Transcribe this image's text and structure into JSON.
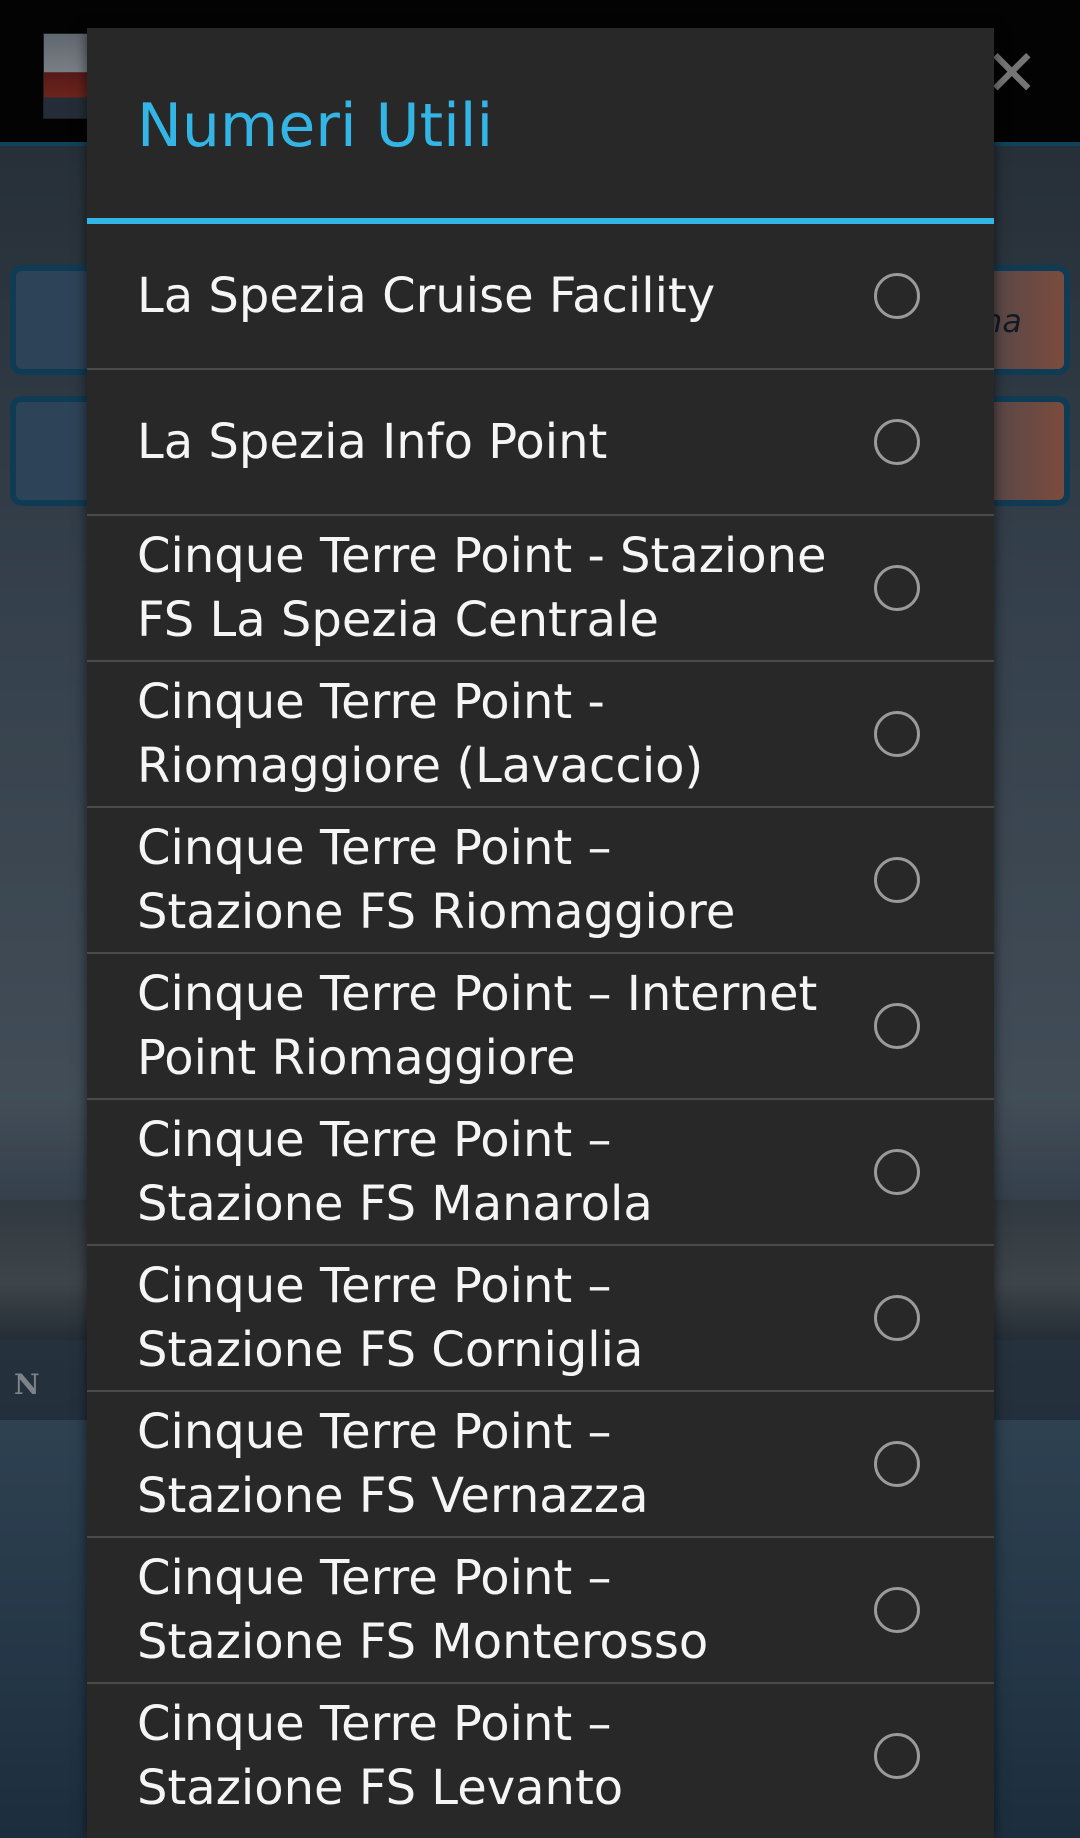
{
  "dialog": {
    "title": "Numeri Utili",
    "options": [
      {
        "label": "La Spezia Cruise Facility",
        "selected": false
      },
      {
        "label": "La Spezia Info Point",
        "selected": false
      },
      {
        "label": "Cinque Terre Point - Stazione FS La Spezia Centrale",
        "selected": false
      },
      {
        "label": "Cinque Terre Point - Riomaggiore (Lavaccio)",
        "selected": false
      },
      {
        "label": "Cinque Terre Point – Stazione FS Riomaggiore",
        "selected": false
      },
      {
        "label": "Cinque Terre Point – Internet Point Riomaggiore",
        "selected": false
      },
      {
        "label": "Cinque Terre Point – Stazione FS Manarola",
        "selected": false
      },
      {
        "label": "Cinque Terre Point – Stazione FS Corniglia",
        "selected": false
      },
      {
        "label": "Cinque Terre Point – Stazione FS Vernazza",
        "selected": false
      },
      {
        "label": "Cinque Terre Point – Stazione FS Monterosso",
        "selected": false
      },
      {
        "label": "Cinque Terre Point – Stazione FS Levanto",
        "selected": false
      }
    ]
  },
  "background": {
    "button_fragment": "na",
    "image_letter": "N",
    "close_icon": "close-icon"
  },
  "colors": {
    "accent": "#33b5e5",
    "dialog_bg": "#282828",
    "divider": "#4a4a4a",
    "text": "#f5f5f5",
    "radio": "#9a9a9a"
  }
}
